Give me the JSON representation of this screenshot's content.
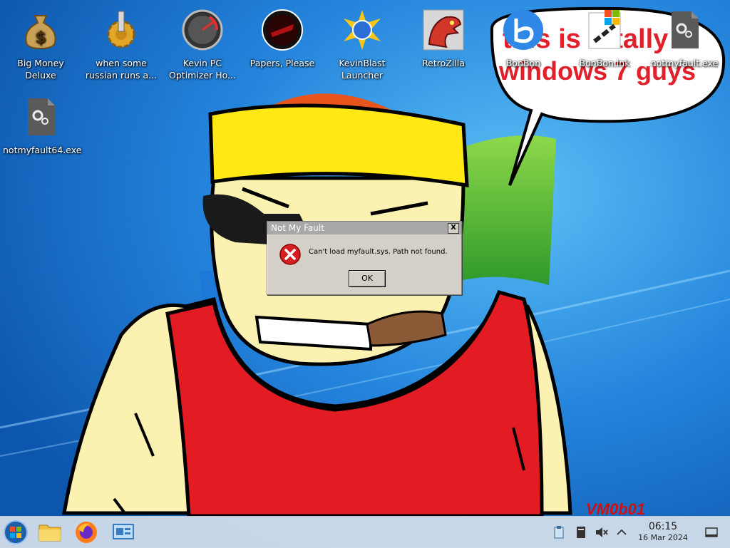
{
  "desktop": {
    "icons": [
      {
        "label": "Big Money Deluxe",
        "icon": "money-bag-icon"
      },
      {
        "label": "when some russian runs a...",
        "icon": "gear-icon"
      },
      {
        "label": "Kevin PC Optimizer Ho...",
        "icon": "speedometer-icon"
      },
      {
        "label": "Papers, Please",
        "icon": "papers-please-icon"
      },
      {
        "label": "KevinBlast Launcher",
        "icon": "starburst-icon"
      },
      {
        "label": "RetroZilla",
        "icon": "dinosaur-icon"
      },
      {
        "label": "BonBon",
        "icon": "bonbon-logo-icon"
      },
      {
        "label": "BonBon.lnk",
        "icon": "shortcut-link-icon"
      },
      {
        "label": "notmyfault.exe",
        "icon": "exe-file-icon"
      },
      {
        "label": "notmyfault64.exe",
        "icon": "exe-file-icon"
      }
    ],
    "speech_bubble": {
      "line1": "this is totally",
      "line2": "windows 7 guys"
    },
    "watermark": "VM0b01"
  },
  "dialog": {
    "title": "Not My Fault",
    "close": "X",
    "message": "Can't load myfault.sys. Path not found.",
    "ok_label": "OK"
  },
  "taskbar": {
    "apps": [
      "start-orb-icon",
      "file-explorer-icon",
      "firefox-icon",
      "control-panel-icon"
    ],
    "tray": [
      "clipboard-icon",
      "storage-icon",
      "volume-muted-icon",
      "chevron-up-icon",
      "show-desktop-icon"
    ],
    "time": "06:15",
    "date": "16 Mar 2024"
  }
}
